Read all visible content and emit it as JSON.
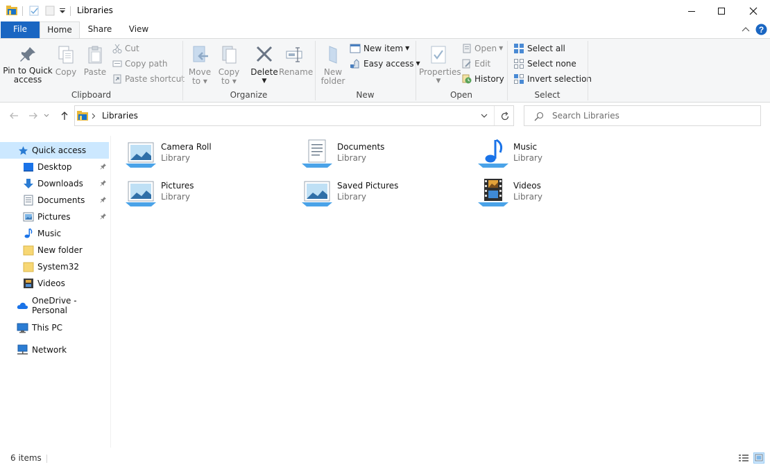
{
  "window": {
    "title": "Libraries",
    "controls": [
      "minimize",
      "maximize",
      "close"
    ]
  },
  "ribbon": {
    "tabs": [
      {
        "label": "File"
      },
      {
        "label": "Home"
      },
      {
        "label": "Share"
      },
      {
        "label": "View"
      }
    ],
    "active_tab": "Home",
    "clipboard": {
      "group_label": "Clipboard",
      "pin_label_1": "Pin to Quick",
      "pin_label_2": "access",
      "copy": "Copy",
      "paste": "Paste",
      "cut": "Cut",
      "copy_path": "Copy path",
      "paste_shortcut": "Paste shortcut"
    },
    "organize": {
      "group_label": "Organize",
      "move_to_1": "Move",
      "move_to_2": "to",
      "copy_to_1": "Copy",
      "copy_to_2": "to",
      "delete": "Delete",
      "rename": "Rename"
    },
    "new": {
      "group_label": "New",
      "new_folder_1": "New",
      "new_folder_2": "folder",
      "new_item": "New item",
      "easy_access": "Easy access"
    },
    "open": {
      "group_label": "Open",
      "properties": "Properties",
      "open": "Open",
      "edit": "Edit",
      "history": "History"
    },
    "select": {
      "group_label": "Select",
      "select_all": "Select all",
      "select_none": "Select none",
      "invert_selection": "Invert selection"
    }
  },
  "address": {
    "breadcrumb": "Libraries",
    "search_placeholder": "Search Libraries"
  },
  "navpane": {
    "quick_access": "Quick access",
    "quick_items": [
      {
        "label": "Desktop",
        "pinned": true
      },
      {
        "label": "Downloads",
        "pinned": true
      },
      {
        "label": "Documents",
        "pinned": true
      },
      {
        "label": "Pictures",
        "pinned": true
      },
      {
        "label": "Music",
        "pinned": false
      },
      {
        "label": "New folder",
        "pinned": false
      },
      {
        "label": "System32",
        "pinned": false
      },
      {
        "label": "Videos",
        "pinned": false
      }
    ],
    "onedrive": "OneDrive - Personal",
    "this_pc": "This PC",
    "network": "Network"
  },
  "libraries": [
    {
      "name": "Camera Roll",
      "type": "Library",
      "icon": "pictures-library-icon"
    },
    {
      "name": "Documents",
      "type": "Library",
      "icon": "documents-library-icon"
    },
    {
      "name": "Music",
      "type": "Library",
      "icon": "music-library-icon"
    },
    {
      "name": "Pictures",
      "type": "Library",
      "icon": "pictures-library-icon"
    },
    {
      "name": "Saved Pictures",
      "type": "Library",
      "icon": "pictures-library-icon"
    },
    {
      "name": "Videos",
      "type": "Library",
      "icon": "videos-library-icon"
    }
  ],
  "status": {
    "item_count": "6 items"
  },
  "colors": {
    "accent": "#1a66c2",
    "selection": "#cce8ff",
    "ribbon_bg": "#f5f6f7"
  }
}
